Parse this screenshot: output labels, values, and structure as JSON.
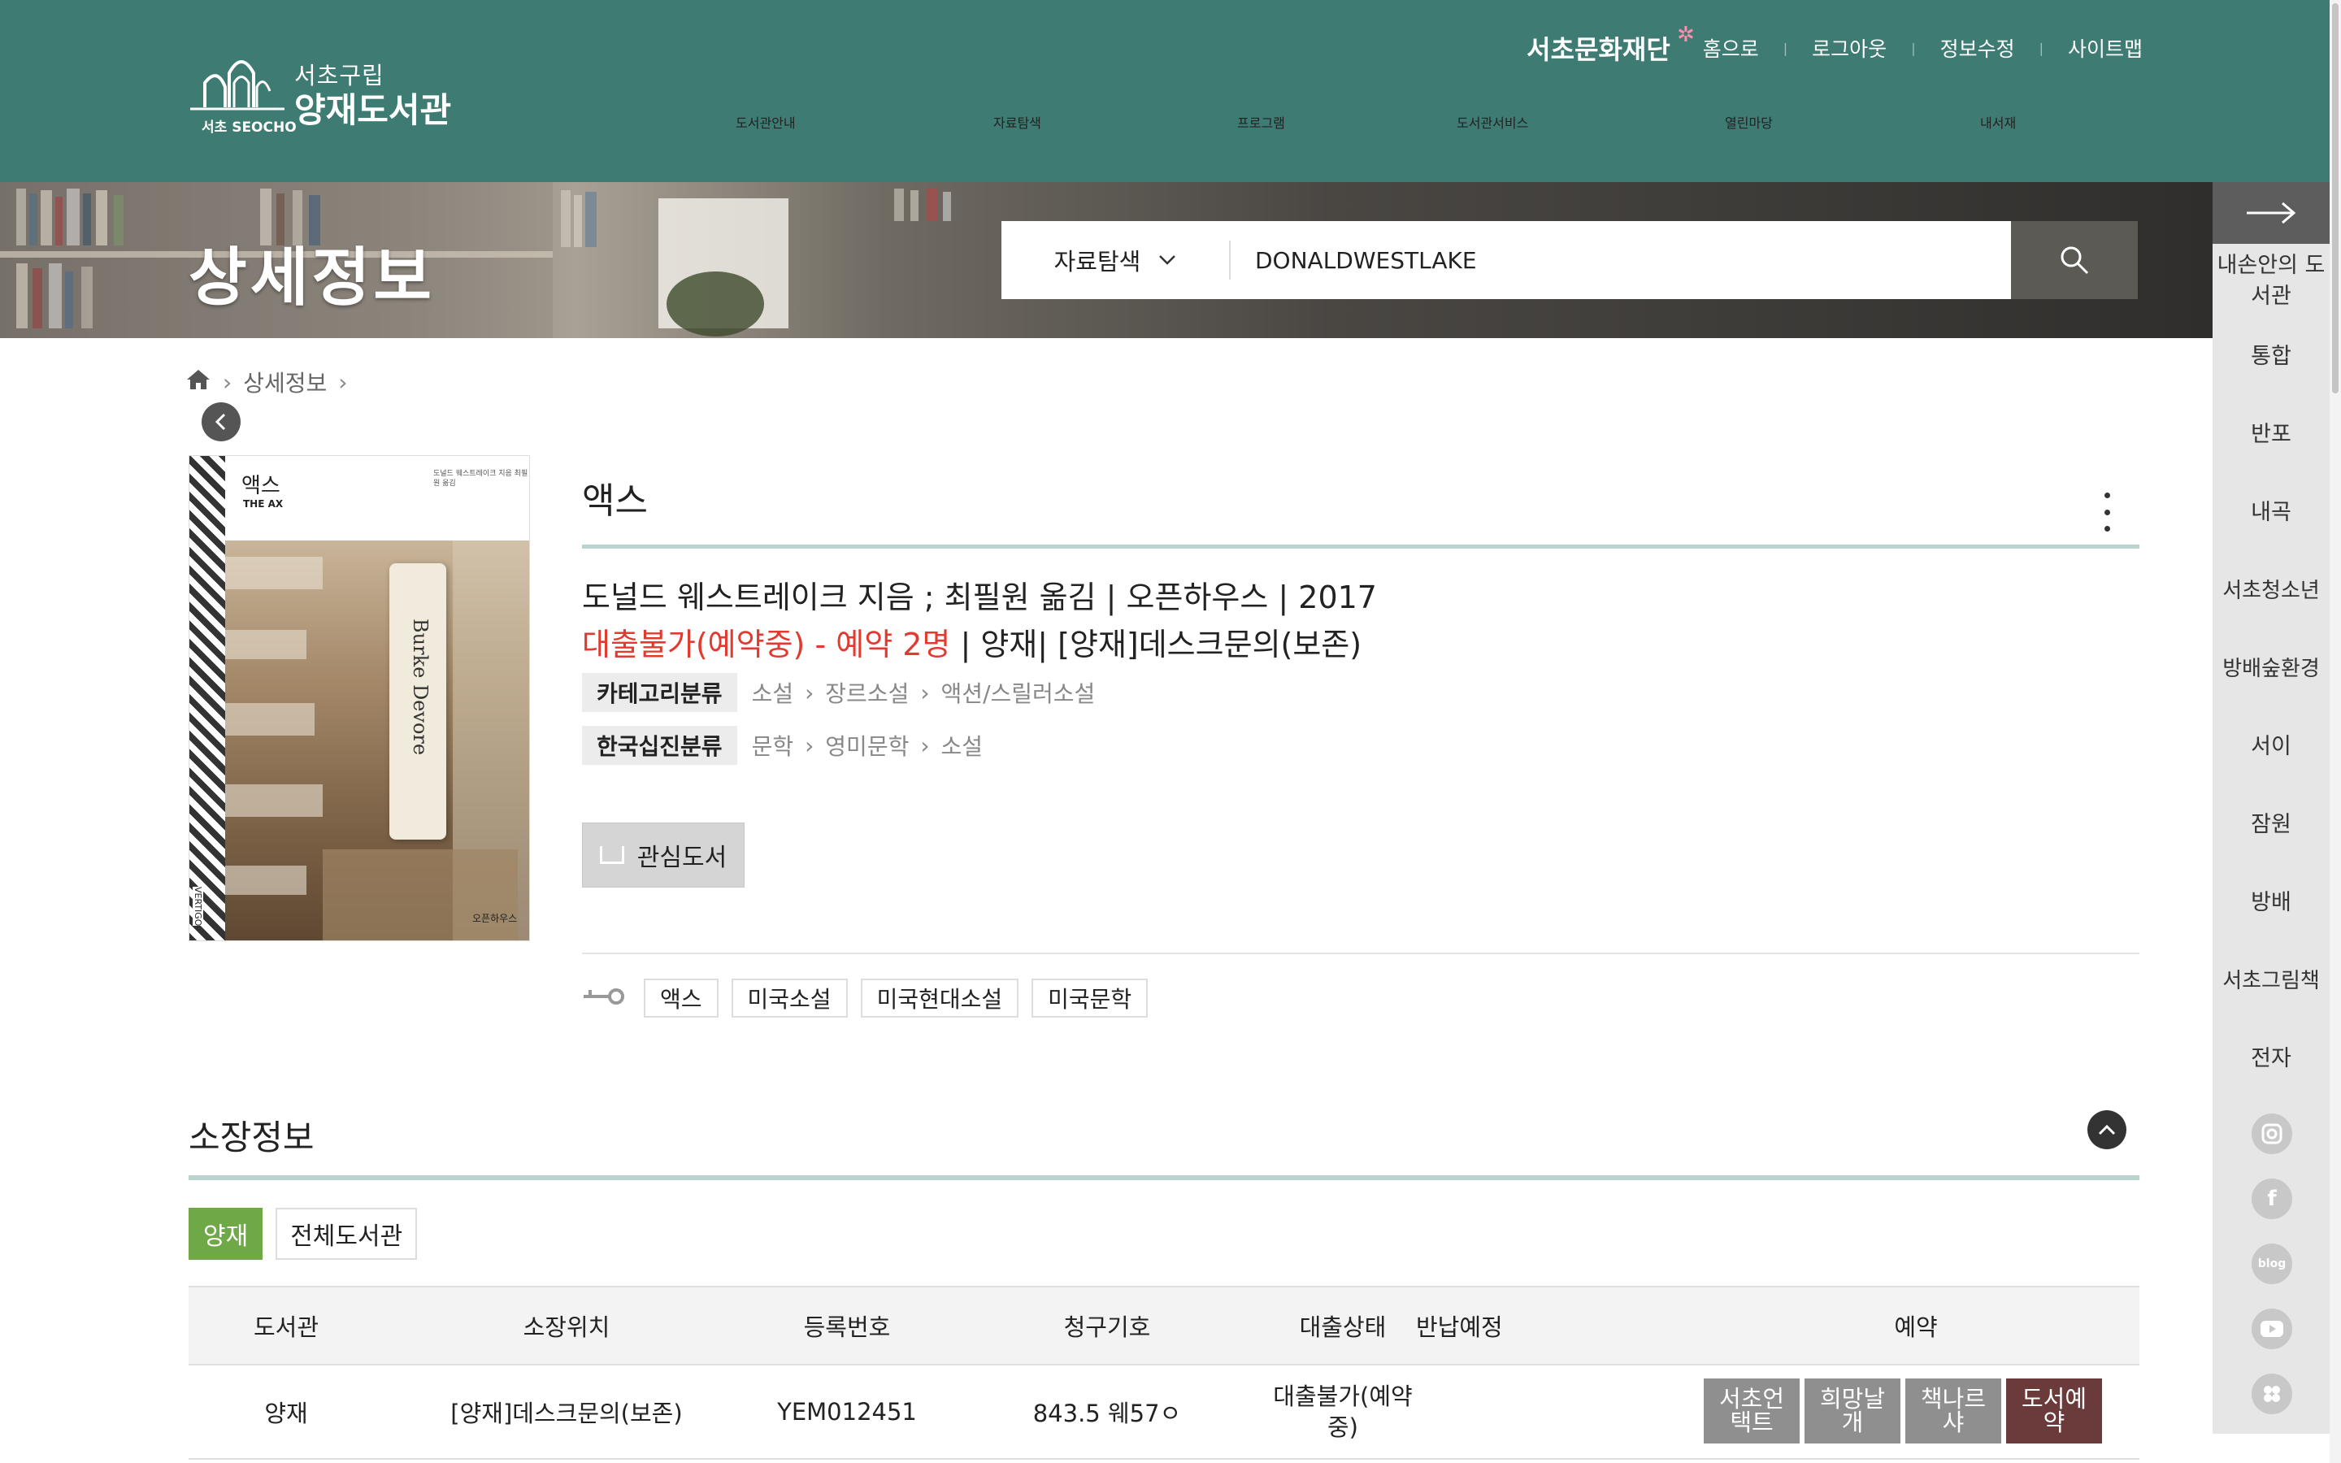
{
  "header": {
    "logo_sub": "서초구립",
    "logo_name": "양재도서관",
    "logo_seocho": "서초 SEOCHO",
    "top_links": {
      "foundation": "서초문화재단",
      "home": "홈으로",
      "logout": "로그아웃",
      "edit_info": "정보수정",
      "sitemap": "사이트맵"
    },
    "gnb": [
      "도서관안내",
      "자료탐색",
      "프로그램",
      "도서관서비스",
      "열린마당",
      "내서재"
    ]
  },
  "banner": {
    "title": "상세정보"
  },
  "search": {
    "select_label": "자료탐색",
    "query": "DONALDWESTLAKE"
  },
  "quick_menu": {
    "title": "내손안의 도서관",
    "items": [
      "통합",
      "반포",
      "내곡",
      "서초청소년",
      "방배숲환경",
      "서이",
      "잠원",
      "방배",
      "서초그림책",
      "전자"
    ],
    "sns": [
      "instagram-icon",
      "facebook-icon",
      "blog-icon",
      "youtube-icon",
      "etc-icon"
    ]
  },
  "breadcrumb": {
    "current": "상세정보"
  },
  "cover": {
    "title": "액스",
    "subtitle": "THE AX",
    "author": "도널드 웨스트레이크 지음 최필원 옮김",
    "tab_text": "Burke Devore",
    "publisher": "오픈하우스",
    "spine_text": "VERTIGO"
  },
  "book": {
    "title": "액스",
    "pubinfo": "도널드 웨스트레이크 지음 ; 최필원 옮김 | 오픈하우스 | 2017",
    "status_red": "대출불가(예약중) - 예약 2명",
    "status_rest": " | 양재| [양재]데스크문의(보존)",
    "category": {
      "label": "카테고리분류",
      "path": [
        "소설",
        "장르소설",
        "액션/스릴러소설"
      ]
    },
    "kdc": {
      "label": "한국십진분류",
      "path": [
        "문학",
        "영미문학",
        "소설"
      ]
    },
    "fav_label": "관심도서",
    "tags": [
      "액스",
      "미국소설",
      "미국현대소설",
      "미국문학"
    ]
  },
  "holdings": {
    "title": "소장정보",
    "tabs": [
      "양재",
      "전체도서관"
    ],
    "columns": [
      "도서관",
      "소장위치",
      "등록번호",
      "청구기호",
      "대출상태",
      "반납예정",
      "예약"
    ],
    "rows": [
      {
        "library": "양재",
        "location": "[양재]데스크문의(보존)",
        "reg_no": "YEM012451",
        "call_no": "843.5 웨57ㅇ",
        "status": "대출불가(예약중)",
        "due": "",
        "buttons": [
          "서초언택트",
          "희망날개",
          "책나르샤",
          "도서예약"
        ]
      }
    ]
  },
  "colors": {
    "header_bg": "#3e7b73",
    "accent_line": "#b9d4cf",
    "status_red": "#e23a2f",
    "tab_active": "#6ea847",
    "reserve_btn": "#6b3a3a"
  }
}
